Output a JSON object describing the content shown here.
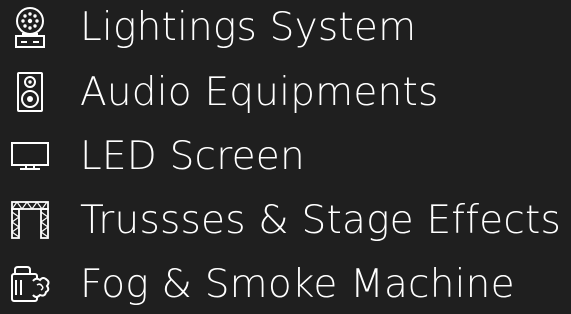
{
  "services": {
    "items": [
      {
        "label": "Lightings System",
        "icon": "stage-light-icon"
      },
      {
        "label": "Audio Equipments",
        "icon": "speaker-icon"
      },
      {
        "label": "LED Screen",
        "icon": "led-screen-icon"
      },
      {
        "label": "Trussses & Stage Effects",
        "icon": "truss-icon"
      },
      {
        "label": "Fog & Smoke Machine",
        "icon": "fog-machine-icon"
      }
    ]
  },
  "colors": {
    "background": "#1f1f1f",
    "text": "#ffffff"
  }
}
